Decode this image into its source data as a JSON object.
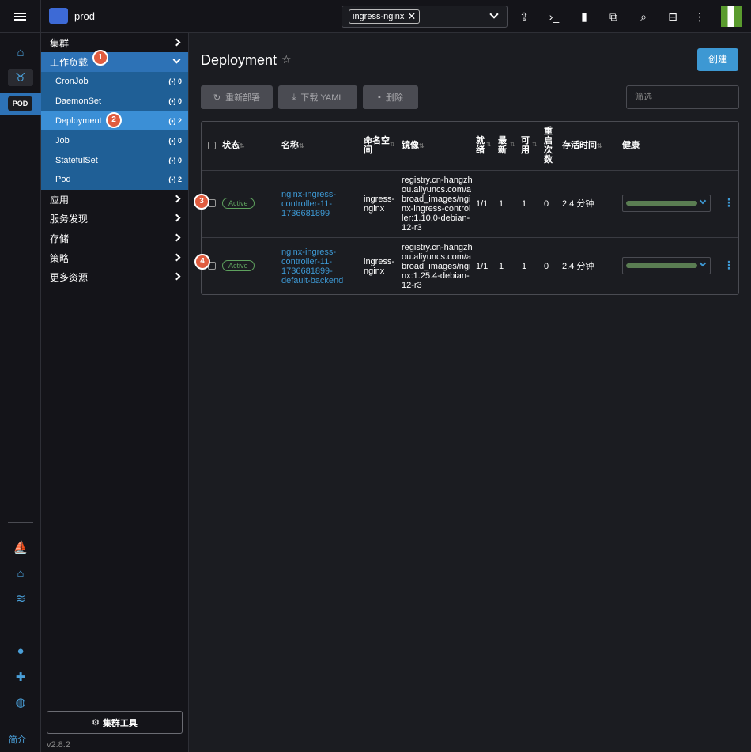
{
  "header": {
    "cluster_name": "prod",
    "namespace_chip": "ingress-nginx",
    "chip_close": "✕"
  },
  "rail": {
    "pod_badge": "POD",
    "about": "简介"
  },
  "sidenav": {
    "groups": [
      {
        "label": "集群"
      },
      {
        "label": "工作负载"
      },
      {
        "label": "应用"
      },
      {
        "label": "服务发现"
      },
      {
        "label": "存储"
      },
      {
        "label": "策略"
      },
      {
        "label": "更多资源"
      }
    ],
    "workload_items": [
      {
        "label": "CronJob",
        "count": "(•) 0"
      },
      {
        "label": "DaemonSet",
        "count": "(•) 0"
      },
      {
        "label": "Deployment",
        "count": "(•) 2"
      },
      {
        "label": "Job",
        "count": "(•) 0"
      },
      {
        "label": "StatefulSet",
        "count": "(•) 0"
      },
      {
        "label": "Pod",
        "count": "(•) 2"
      }
    ],
    "cluster_tools": "集群工具",
    "version": "v2.8.2"
  },
  "main": {
    "title": "Deployment",
    "create_button": "创建",
    "redeploy_button": "重新部署",
    "download_yaml_button": "下载 YAML",
    "delete_button": "删除",
    "filter_placeholder": "筛选"
  },
  "table": {
    "headers": {
      "status": "状态",
      "name": "名称",
      "namespace_line1": "命名空",
      "namespace_line2": "间",
      "image": "镜像",
      "ready_1": "就",
      "ready_2": "绪",
      "latest_1": "最",
      "latest_2": "新",
      "available_1": "可",
      "available_2": "用",
      "restarts_1": "重",
      "restarts_2": "启",
      "restarts_3": "次",
      "restarts_4": "数",
      "age": "存活时间",
      "health": "健康"
    },
    "rows": [
      {
        "status": "Active",
        "name_lines": [
          "nginx-ingress-",
          "controller-11-",
          "1736681899"
        ],
        "namespace_lines": [
          "ingress-",
          "nginx"
        ],
        "image_lines": [
          "registry.cn-hangzh",
          "ou.aliyuncs.com/a",
          "broad_images/ngi",
          "nx-ingress-control",
          "ler:1.10.0-debian-",
          "12-r3"
        ],
        "ready": "1/1",
        "latest": "1",
        "available": "1",
        "restarts": "0",
        "age": "2.4 分钟",
        "health": 1.0
      },
      {
        "status": "Active",
        "name_lines": [
          "nginx-ingress-",
          "controller-11-",
          "1736681899-",
          "default-backend"
        ],
        "namespace_lines": [
          "ingress-",
          "nginx"
        ],
        "image_lines": [
          "registry.cn-hangzh",
          "ou.aliyuncs.com/a",
          "broad_images/ngi",
          "nx:1.25.4-debian-",
          "12-r3"
        ],
        "ready": "1/1",
        "latest": "1",
        "available": "1",
        "restarts": "0",
        "age": "2.4 分钟",
        "health": 1.0
      }
    ]
  },
  "markers": [
    "1",
    "2",
    "3",
    "4"
  ],
  "colors": {
    "accent": "#3d98d3",
    "nav_active": "#2d72b6",
    "active_badge": "#5ea15e",
    "marker": "#e05c3f"
  }
}
